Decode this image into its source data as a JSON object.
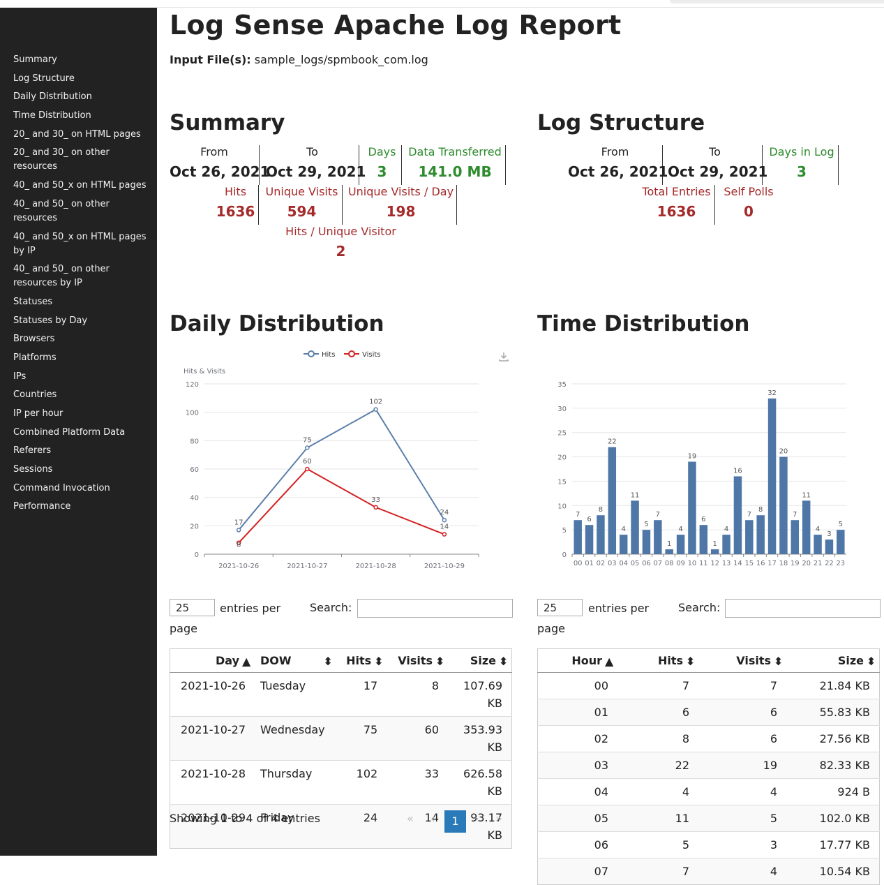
{
  "sidebar": {
    "items": [
      "Summary",
      "Log Structure",
      "Daily Distribution",
      "Time Distribution",
      "20_ and 30_ on HTML pages",
      "20_ and 30_ on other resources",
      "40_ and 50_x on HTML pages",
      "40_ and 50_ on other resources",
      "40_ and 50_x on HTML pages by IP",
      "40_ and 50_ on other resources by IP",
      "Statuses",
      "Statuses by Day",
      "Browsers",
      "Platforms",
      "IPs",
      "Countries",
      "IP per hour",
      "Combined Platform Data",
      "Referers",
      "Sessions",
      "Command Invocation",
      "Performance"
    ]
  },
  "report": {
    "title": "Log Sense Apache Log Report",
    "input_label": "Input File(s):",
    "input_value": "sample_logs/spmbook_com.log"
  },
  "summary": {
    "heading": "Summary",
    "from_label": "From",
    "from_value": "Oct 26, 2021",
    "to_label": "To",
    "to_value": "Oct 29, 2021",
    "days_label": "Days",
    "days_value": "3",
    "data_label": "Data Transferred",
    "data_value": "141.0 MB",
    "hits_label": "Hits",
    "hits_value": "1636",
    "uv_label": "Unique Visits",
    "uv_value": "594",
    "uvd_label": "Unique Visits / Day",
    "uvd_value": "198",
    "huv_label": "Hits / Unique Visitor",
    "huv_value": "2"
  },
  "structure": {
    "heading": "Log Structure",
    "from_label": "From",
    "from_value": "Oct 26, 2021",
    "to_label": "To",
    "to_value": "Oct 29, 2021",
    "days_label": "Days in Log",
    "days_value": "3",
    "entries_label": "Total Entries",
    "entries_value": "1636",
    "polls_label": "Self Polls",
    "polls_value": "0"
  },
  "daily": {
    "heading": "Daily Distribution",
    "entries_value": "25",
    "entries_label": "entries per page",
    "search_label": "Search:",
    "columns": [
      "Day",
      "DOW",
      "Hits",
      "Visits",
      "Size"
    ],
    "rows": [
      [
        "2021-10-26",
        "Tuesday",
        "17",
        "8",
        "107.69 KB"
      ],
      [
        "2021-10-27",
        "Wednesday",
        "75",
        "60",
        "353.93 KB"
      ],
      [
        "2021-10-28",
        "Thursday",
        "102",
        "33",
        "626.58 KB"
      ],
      [
        "2021-10-29",
        "Friday",
        "24",
        "14",
        "93.17 KB"
      ]
    ],
    "showing": "Showing 1 to 4 of 4 entries",
    "pager": {
      "first": "«",
      "prev": "‹",
      "page": "1",
      "next": "›",
      "last": "»"
    }
  },
  "time": {
    "heading": "Time Distribution",
    "entries_value": "25",
    "entries_label": "entries per page",
    "search_label": "Search:",
    "columns": [
      "Hour",
      "Hits",
      "Visits",
      "Size"
    ],
    "rows": [
      [
        "00",
        "7",
        "7",
        "21.84 KB"
      ],
      [
        "01",
        "6",
        "6",
        "55.83 KB"
      ],
      [
        "02",
        "8",
        "6",
        "27.56 KB"
      ],
      [
        "03",
        "22",
        "19",
        "82.33 KB"
      ],
      [
        "04",
        "4",
        "4",
        "924 B"
      ],
      [
        "05",
        "11",
        "5",
        "102.0 KB"
      ],
      [
        "06",
        "5",
        "3",
        "17.77 KB"
      ],
      [
        "07",
        "7",
        "4",
        "10.54 KB"
      ]
    ]
  },
  "chart_data": [
    {
      "type": "line",
      "ylabel": "Hits & Visits",
      "x": [
        "2021-10-26",
        "2021-10-27",
        "2021-10-28",
        "2021-10-29"
      ],
      "ylim": [
        0,
        120
      ],
      "yticks": [
        0,
        20,
        40,
        60,
        80,
        100,
        120
      ],
      "legend": "top-center",
      "grid": true,
      "series": [
        {
          "name": "Hits",
          "values": [
            17,
            75,
            102,
            24
          ],
          "color": "#5b7faa"
        },
        {
          "name": "Visits",
          "values": [
            8,
            60,
            33,
            14
          ],
          "color": "#d42020"
        }
      ]
    },
    {
      "type": "bar",
      "categories": [
        "00",
        "01",
        "02",
        "03",
        "04",
        "05",
        "06",
        "07",
        "08",
        "09",
        "10",
        "11",
        "12",
        "13",
        "14",
        "15",
        "16",
        "17",
        "18",
        "19",
        "20",
        "21",
        "22",
        "23"
      ],
      "values": [
        7,
        6,
        8,
        22,
        4,
        11,
        5,
        7,
        1,
        4,
        19,
        6,
        1,
        4,
        16,
        7,
        8,
        32,
        20,
        7,
        11,
        4,
        3,
        5
      ],
      "ylim": [
        0,
        35
      ],
      "yticks": [
        0,
        5,
        10,
        15,
        20,
        25,
        30,
        35
      ],
      "grid": true,
      "color": "#4e76a6"
    }
  ]
}
